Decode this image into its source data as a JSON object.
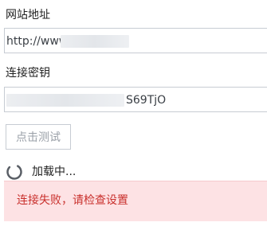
{
  "form": {
    "url_label": "网站地址",
    "url_value_visible": "http://www",
    "key_label": "连接密钥",
    "key_value_visible": "S69TjO",
    "test_button_label": "点击测试"
  },
  "status": {
    "loading_text": "加载中...",
    "error_message": "连接失败，请检查设置"
  },
  "colors": {
    "error_background": "#fde2e4",
    "error_text": "#c9302c",
    "border": "#c7ccd3"
  }
}
